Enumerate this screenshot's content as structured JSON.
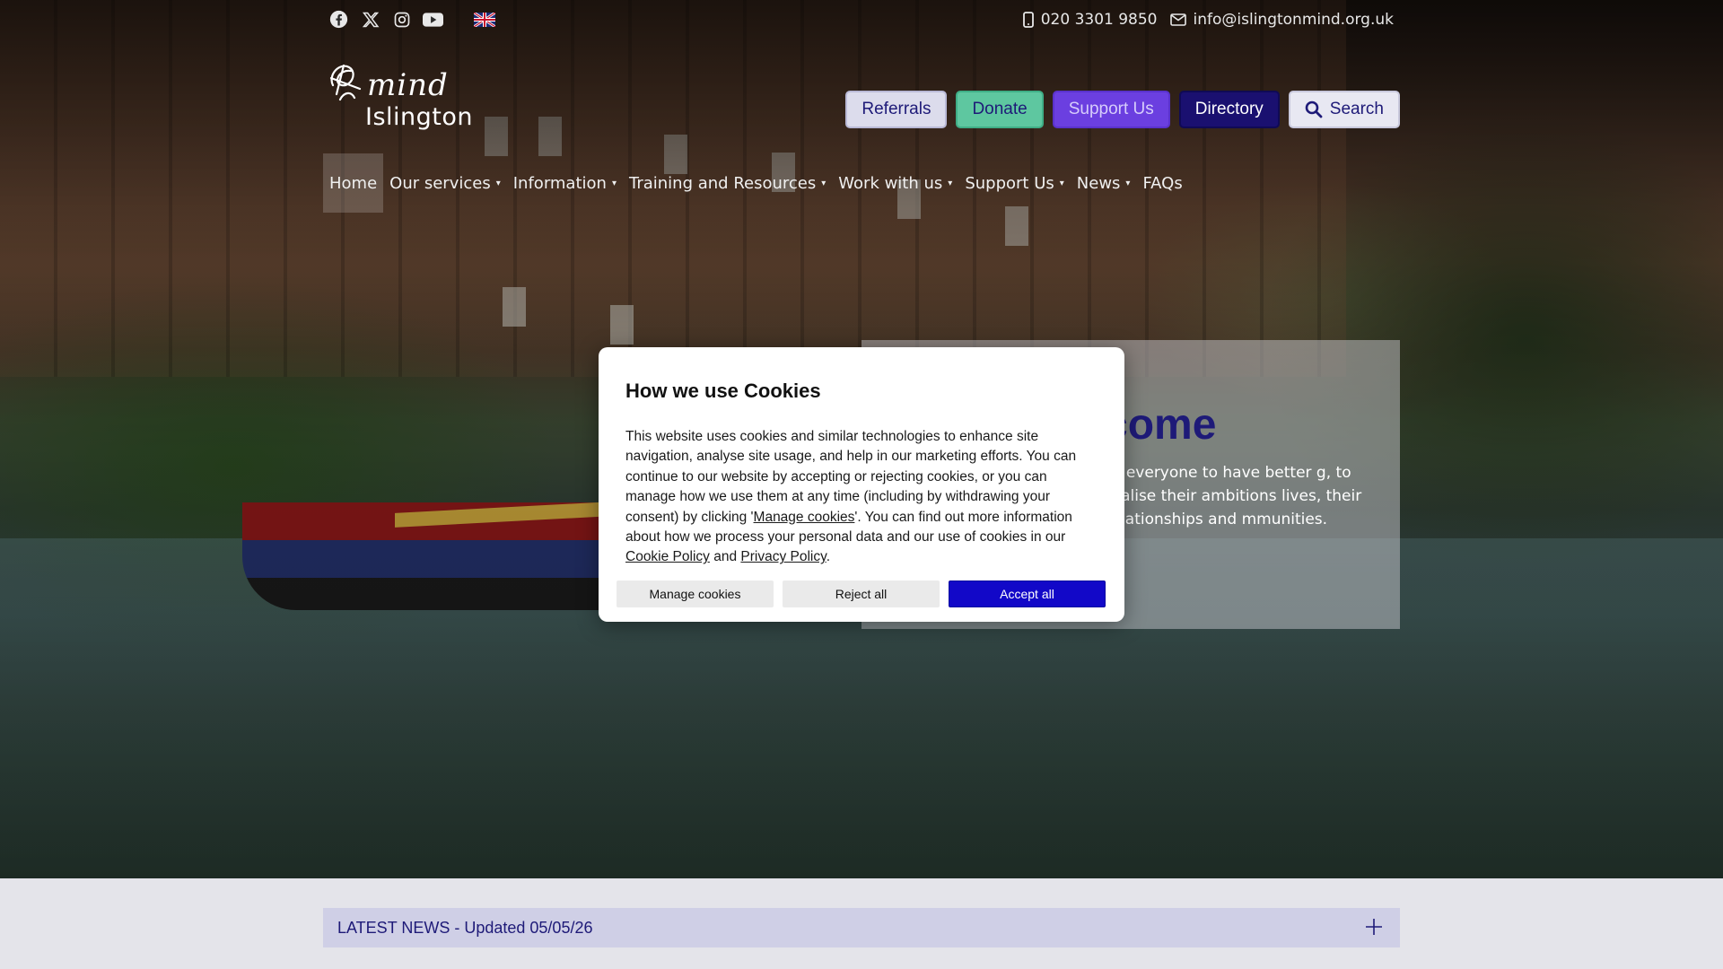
{
  "social": {
    "icons": [
      "facebook-icon",
      "x-twitter-icon",
      "instagram-icon",
      "youtube-icon",
      "uk-flag-icon"
    ]
  },
  "contact": {
    "phone": "020 3301 9850",
    "email": "info@islingtonmind.org.uk"
  },
  "logo": {
    "brand": "mind",
    "place": "Islington"
  },
  "actions": {
    "referrals": "Referrals",
    "donate": "Donate",
    "support_us": "Support Us",
    "directory": "Directory",
    "search": "Search"
  },
  "nav": {
    "items": [
      {
        "label": "Home"
      },
      {
        "label": "Our services"
      },
      {
        "label": "Information"
      },
      {
        "label": "Training and Resources"
      },
      {
        "label": "Work with us"
      },
      {
        "label": "Support Us"
      },
      {
        "label": "News"
      },
      {
        "label": "FAQs"
      }
    ]
  },
  "welcome": {
    "title": "come",
    "text": "nt everyone to have better g, to realise their ambitions lives, their relationships and mmunities."
  },
  "cookie": {
    "title": "How we use Cookies",
    "body_1": "This website uses cookies and similar technologies to enhance site navigation, analyse site usage, and help in our marketing efforts. You can continue to our website by accepting or rejecting cookies, or you can manage how we use them at any time (including by withdrawing your consent) by clicking '",
    "manage_link": "Manage cookies",
    "body_2": "'. You can find out more information about how we process your personal data and our use of cookies in our ",
    "cookie_policy_link": "Cookie Policy",
    "body_3": " and ",
    "privacy_policy_link": "Privacy Policy",
    "body_4": ".",
    "manage_button": "Manage cookies",
    "reject_button": "Reject all",
    "accept_button": "Accept all"
  },
  "news": {
    "label": "LATEST NEWS - Updated 05/05/26"
  },
  "colors": {
    "brand_navy": "#1e1a78",
    "donate_green": "#5ec7a0",
    "support_purple": "#6b3fe0",
    "directory_navy": "#1a1070",
    "accept_blue": "#1208c8"
  }
}
